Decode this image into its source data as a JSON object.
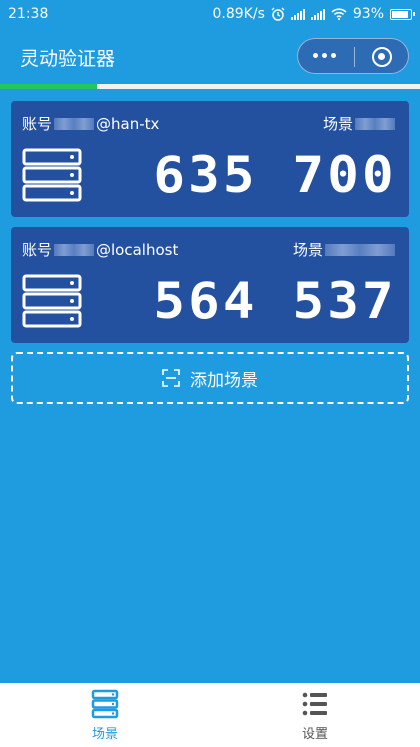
{
  "status_bar": {
    "time": "21:38",
    "speed": "0.89K/s",
    "battery": "93%"
  },
  "header": {
    "title": "灵动验证器"
  },
  "progress": {
    "fraction": 0.23
  },
  "cards": [
    {
      "account_label": "账号",
      "account_suffix": "@han-tx",
      "scene_label": "场景",
      "code": "635 700"
    },
    {
      "account_label": "账号",
      "account_suffix": "@localhost",
      "scene_label": "场景",
      "code": "564 537"
    }
  ],
  "add_button": {
    "label": "添加场景"
  },
  "tabbar": {
    "tabs": [
      {
        "label": "场景",
        "icon": "server-stack-icon"
      },
      {
        "label": "设置",
        "icon": "list-icon"
      }
    ]
  },
  "colors": {
    "accent": "#1f9be0",
    "card": "#2450a0",
    "progress": "#22c55e"
  }
}
